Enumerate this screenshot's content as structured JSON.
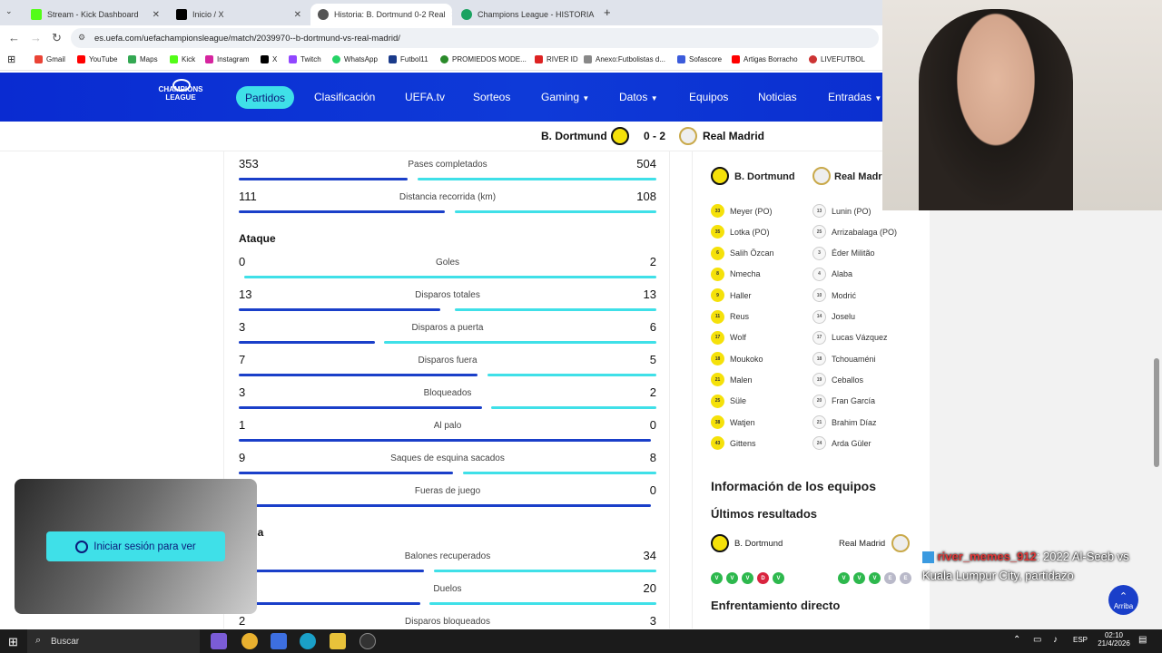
{
  "tabs": [
    {
      "label": "Stream - Kick Dashboard",
      "color": "#53fc18"
    },
    {
      "label": "Inicio / X",
      "color": "#000000"
    },
    {
      "label": "Historia: B. Dortmund 0-2 Real",
      "color": "#555555"
    },
    {
      "label": "Champions League - HISTORIA",
      "color": "#1aa260"
    }
  ],
  "url": "es.uefa.com/uefachampionsleague/match/2039970--b-dortmund-vs-real-madrid/",
  "bookmarks": [
    "Gmail",
    "YouTube",
    "Maps",
    "Kick",
    "Instagram",
    "X",
    "Twitch",
    "WhatsApp",
    "Futbol11",
    "PROMIEDOS MODE...",
    "RIVER ID",
    "Anexo:Futbolistas d...",
    "Sofascore",
    "Artigas Borracho",
    "LIVEFUTBOL"
  ],
  "nav": {
    "logo": "CHAMPIONS LEAGUE",
    "items": [
      "Partidos",
      "Clasificación",
      "UEFA.tv",
      "Sorteos",
      "Gaming",
      "Datos",
      "Equipos",
      "Noticias",
      "Entradas"
    ]
  },
  "match": {
    "home": "B. Dortmund",
    "score": "0 - 2",
    "away": "Real Madrid",
    "home_color": "#f5e10a",
    "away_color": "#eeeeee"
  },
  "stats_top": [
    {
      "label": "Pases completados",
      "left": "353",
      "right": "504",
      "lw": 0.41,
      "rw": 0.58
    },
    {
      "label": "Distancia recorrida (km)",
      "left": "111",
      "right": "108",
      "lw": 0.5,
      "rw": 0.49
    }
  ],
  "section_attack": "Ataque",
  "stats_attack": [
    {
      "label": "Goles",
      "left": "0",
      "right": "2",
      "lw": 0.0,
      "rw": 1.0
    },
    {
      "label": "Disparos totales",
      "left": "13",
      "right": "13",
      "lw": 0.49,
      "rw": 0.49
    },
    {
      "label": "Disparos a puerta",
      "left": "3",
      "right": "6",
      "lw": 0.33,
      "rw": 0.66
    },
    {
      "label": "Disparos fuera",
      "left": "7",
      "right": "5",
      "lw": 0.58,
      "rw": 0.41
    },
    {
      "label": "Bloqueados",
      "left": "3",
      "right": "2",
      "lw": 0.59,
      "rw": 0.4
    },
    {
      "label": "Al palo",
      "left": "1",
      "right": "0",
      "lw": 1.0,
      "rw": 0.0
    },
    {
      "label": "Saques de esquina sacados",
      "left": "9",
      "right": "8",
      "lw": 0.52,
      "rw": 0.47
    },
    {
      "label": "Fueras de juego",
      "left": "",
      "right": "0",
      "lw": 1.0,
      "rw": 0.0
    }
  ],
  "section_defense": "ensa",
  "stats_defense": [
    {
      "label": "Balones recuperados",
      "left": "",
      "right": "34",
      "lw": 0.45,
      "rw": 0.54
    },
    {
      "label": "Duelos",
      "left": "",
      "right": "20",
      "lw": 0.44,
      "rw": 0.55
    },
    {
      "label": "Disparos bloqueados",
      "left": "2",
      "right": "3",
      "lw": 0.4,
      "rw": 0.6
    }
  ],
  "lineups": {
    "home_team": "B. Dortmund",
    "away_team": "Real Madri",
    "home": [
      [
        "33",
        "Meyer (PO)"
      ],
      [
        "35",
        "Lotka (PO)"
      ],
      [
        "6",
        "Salih Özcan"
      ],
      [
        "8",
        "Nmecha"
      ],
      [
        "9",
        "Haller"
      ],
      [
        "11",
        "Reus"
      ],
      [
        "17",
        "Wolf"
      ],
      [
        "18",
        "Moukoko"
      ],
      [
        "21",
        "Malen"
      ],
      [
        "25",
        "Süle"
      ],
      [
        "38",
        "Watjen"
      ],
      [
        "43",
        "Gittens"
      ]
    ],
    "away": [
      [
        "13",
        "Lunin (PO)"
      ],
      [
        "25",
        "Arrizabalaga (PO)"
      ],
      [
        "3",
        "Éder Militão"
      ],
      [
        "4",
        "Alaba"
      ],
      [
        "10",
        "Modrić"
      ],
      [
        "14",
        "Joselu"
      ],
      [
        "17",
        "Lucas Vázquez"
      ],
      [
        "18",
        "Tchouaméni"
      ],
      [
        "19",
        "Ceballos"
      ],
      [
        "20",
        "Fran García"
      ],
      [
        "21",
        "Brahim Díaz"
      ],
      [
        "24",
        "Arda Güler"
      ]
    ]
  },
  "info": {
    "title": "Información de los equipos",
    "last": "Últimos resultados",
    "home": "B. Dortmund",
    "away": "Real Madrid",
    "home_res": [
      [
        "V",
        "#2db84d"
      ],
      [
        "V",
        "#2db84d"
      ],
      [
        "V",
        "#2db84d"
      ],
      [
        "D",
        "#d9243f"
      ],
      [
        "V",
        "#2db84d"
      ]
    ],
    "away_res": [
      [
        "V",
        "#2db84d"
      ],
      [
        "V",
        "#2db84d"
      ],
      [
        "V",
        "#2db84d"
      ],
      [
        "E",
        "#b9b9c9"
      ],
      [
        "E",
        "#b9b9c9"
      ]
    ],
    "h2h": "Enfrentamiento directo"
  },
  "overlay": {
    "login": "Iniciar sesión para ver"
  },
  "chat": {
    "user": "river_memes_912",
    "text": ": 2022 Al-Seeb vs Kuala Lumpur City, partidazo"
  },
  "arriba": "Arriba",
  "taskbar": {
    "search": "Buscar",
    "lang": "ESP",
    "time": "02:10",
    "date": "21/4/2026"
  }
}
